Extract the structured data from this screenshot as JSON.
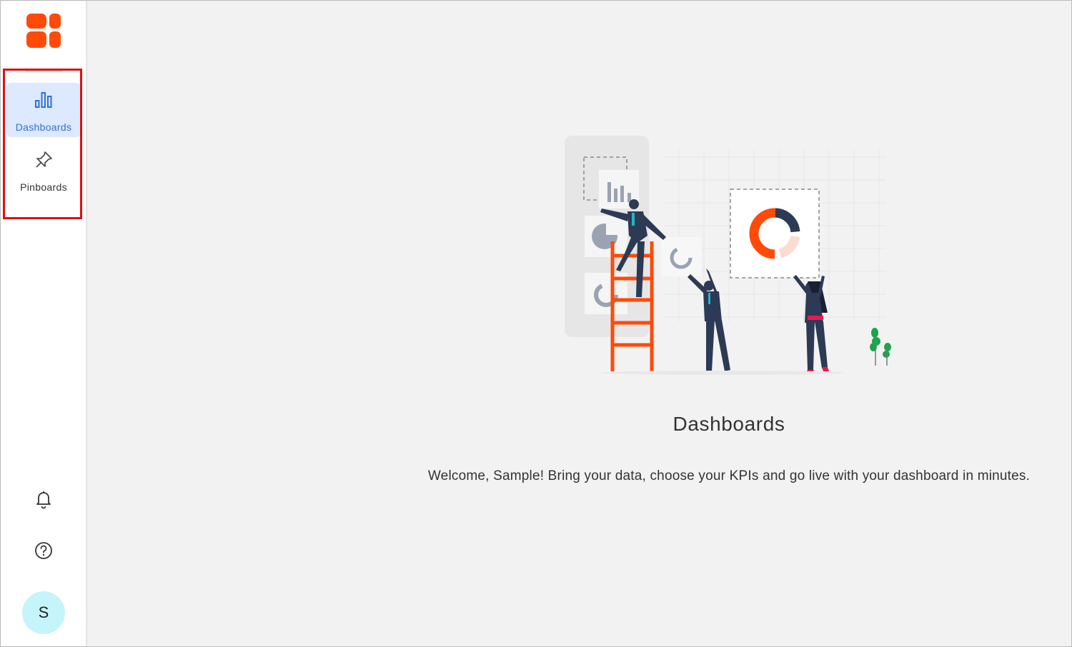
{
  "sidebar": {
    "items": [
      {
        "label": "Dashboards",
        "icon": "bar-chart-icon",
        "active": true
      },
      {
        "label": "Pinboards",
        "icon": "pin-icon",
        "active": false
      }
    ],
    "bottom": {
      "notifications_icon": "bell-icon",
      "help_icon": "help-circle-icon",
      "avatar_initial": "S"
    }
  },
  "main": {
    "title": "Dashboards",
    "welcome": "Welcome, Sample! Bring your data, choose your KPIs and go live with your dashboard in minutes."
  },
  "colors": {
    "brand": "#ff4a0a",
    "active_bg": "#dce9ff",
    "active_text": "#2f6fdc",
    "highlight_border": "#e01010",
    "avatar_bg": "#c6f4fb"
  }
}
